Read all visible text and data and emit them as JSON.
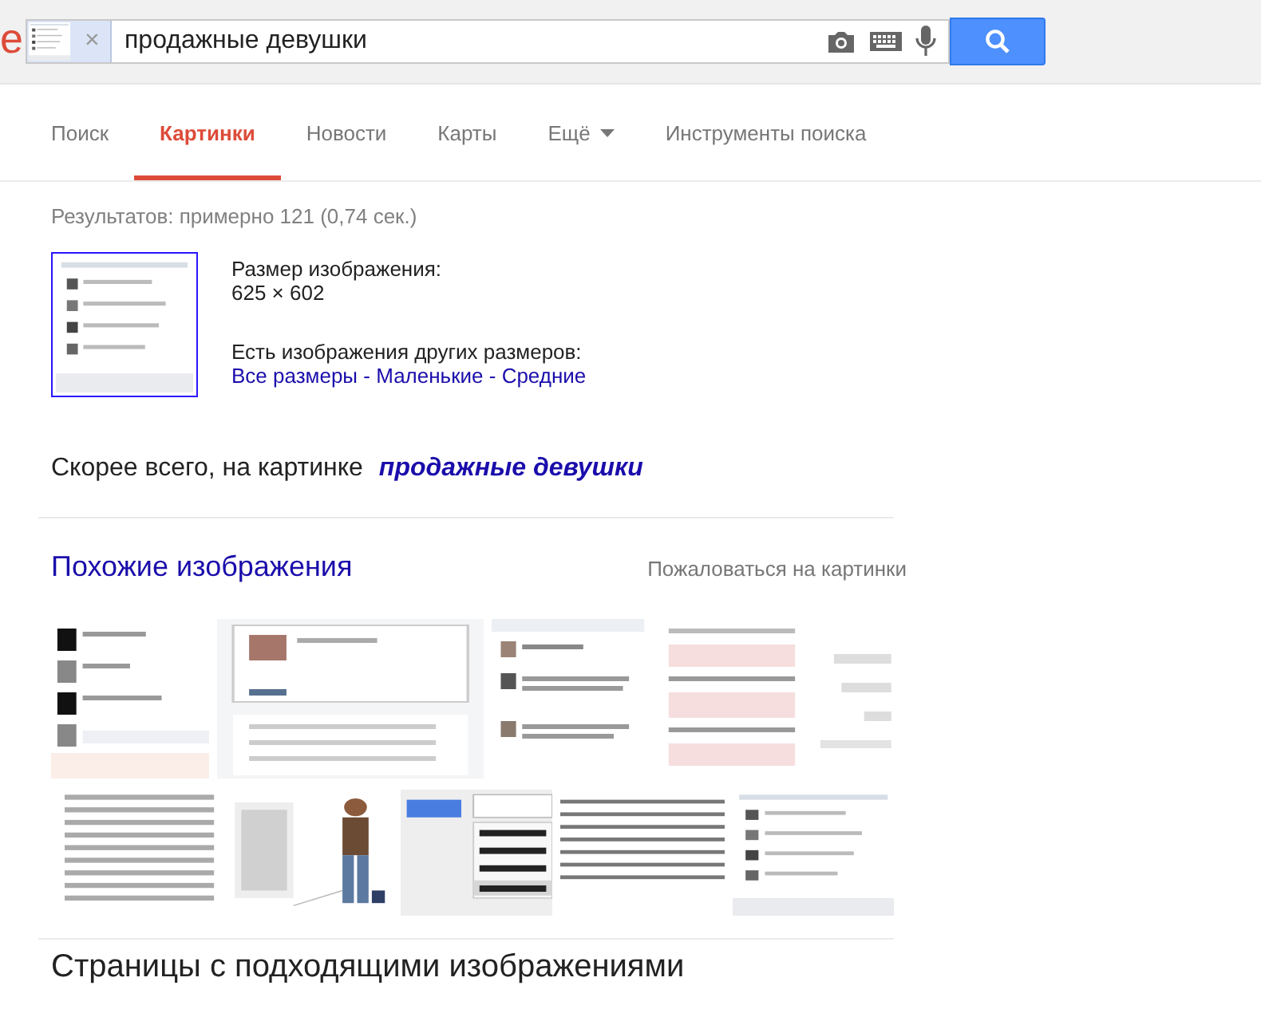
{
  "logo_fragment": "e",
  "search": {
    "value": "продажные девушки",
    "image_chip": {
      "kind": "picture",
      "remove": "×"
    }
  },
  "tabs": [
    {
      "label": "Поиск",
      "selected": false
    },
    {
      "label": "Картинки",
      "selected": true
    },
    {
      "label": "Новости",
      "selected": false
    },
    {
      "label": "Карты",
      "selected": false
    },
    {
      "label": "Ещё",
      "selected": false,
      "dropdown": true
    },
    {
      "label": "Инструменты поиска",
      "selected": false
    }
  ],
  "result_stats": "Результатов: примерно 121 (0,74 сек.)",
  "image_info": {
    "size_label": "Размер изображения:",
    "size": "625 × 602",
    "other_sizes_label": "Есть изображения других размеров:",
    "size_links": [
      "Все размеры",
      "Маленькие",
      "Средние"
    ],
    "separator": " - "
  },
  "best_guess": {
    "label": "Скорее всего, на картинке",
    "query": "продажные девушки"
  },
  "similar": {
    "title": "Похожие изображения",
    "report": "Пожаловаться на картинки"
  },
  "pages_heading": "Страницы с подходящими изображениями"
}
